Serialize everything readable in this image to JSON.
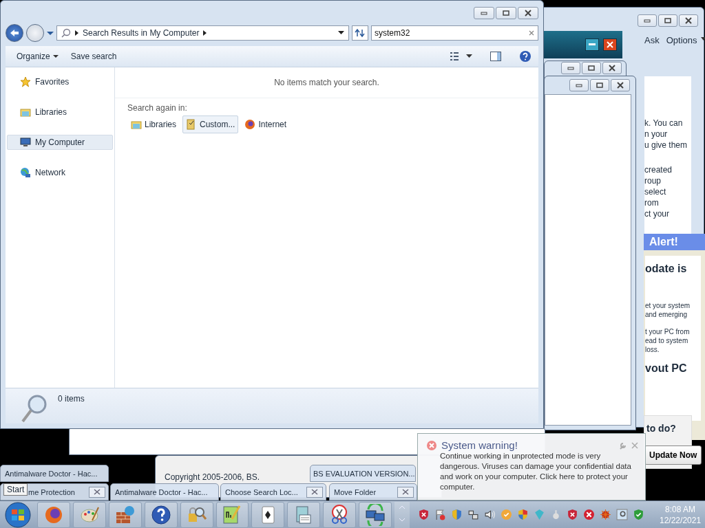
{
  "explorer": {
    "address_crumb": "Search Results in My Computer",
    "search_value": "system32",
    "commands": [
      "Organize",
      "Save search"
    ],
    "nav": [
      {
        "label": "Favorites",
        "selected": false
      },
      {
        "label": "Libraries",
        "selected": false
      },
      {
        "label": "My Computer",
        "selected": true
      },
      {
        "label": "Network",
        "selected": false
      }
    ],
    "message": "No items match your search.",
    "search_again_label": "Search again in:",
    "search_again": [
      {
        "label": "Libraries",
        "selected": false
      },
      {
        "label": "Custom...",
        "selected": true
      },
      {
        "label": "Internet",
        "selected": false
      }
    ],
    "status": "0 items"
  },
  "background_window": {
    "menu": [
      "Ask",
      "Options"
    ],
    "paragraphs": [
      [
        "k. You can",
        "n your",
        "u give them"
      ],
      [
        "created",
        "roup",
        "select",
        "rom",
        "ct your"
      ]
    ]
  },
  "alert_window": {
    "title": "Alert!",
    "heading": "odate is",
    "paragraphs": [
      [
        "et your system",
        "and emerging"
      ],
      [
        "t your PC from",
        "ead to system",
        "loss."
      ]
    ],
    "subheading": "vout PC",
    "question": "to do?",
    "button": "Update Now"
  },
  "copyright": "Copyright 2005-2006, BS.",
  "thumbnails": [
    {
      "title": "Antimalware Doctor - Hac...",
      "closable": false
    },
    {
      "title": "BS EVALUATION VERSION...",
      "closable": false
    },
    {
      "title": "me Protection",
      "closable": true
    },
    {
      "title": "Antimalware Doctor - Hac...",
      "closable": false
    },
    {
      "title": "Choose Search Loc...",
      "closable": true
    },
    {
      "title": "Move Folder",
      "closable": true
    }
  ],
  "start_tooltip": "Start",
  "balloon": {
    "title": "System warning!",
    "text": "Continue working in unprotected mode is very dangerous. Viruses can damage your confidential data and work on your computer. Click here to protect your computer."
  },
  "clock": {
    "time": "8:08 AM",
    "date": "12/22/2021"
  }
}
